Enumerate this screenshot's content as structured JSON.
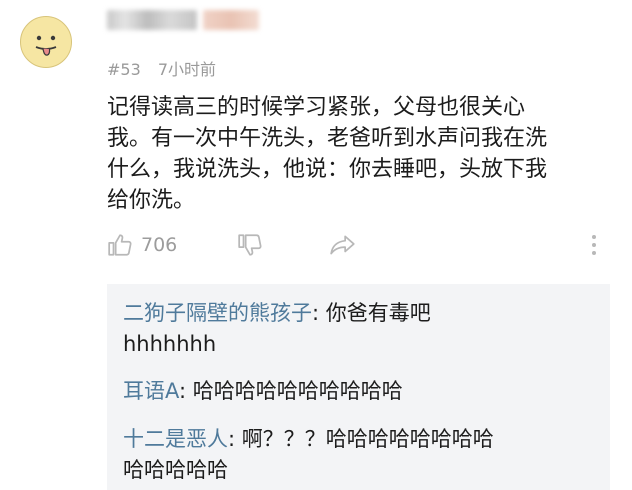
{
  "post": {
    "floor": "#53",
    "time": "7小时前",
    "content_lines": [
      "记得读高三的时候学习紧张，父母也很关心",
      "我。有一次中午洗头，老爸听到水声问我在洗",
      "什么，我说洗头，他说：你去睡吧，头放下我",
      "给你洗。"
    ]
  },
  "actions": {
    "like_icon": "thumbs-up-icon",
    "like_count": "706",
    "dislike_icon": "thumbs-down-icon",
    "share_icon": "share-arrow-icon",
    "more_icon": "vertical-ellipsis-icon"
  },
  "replies": [
    {
      "author": "二狗子隔壁的熊孩子",
      "separator": ": ",
      "lines": [
        "你爸有毒吧",
        "hhhhhhh"
      ]
    },
    {
      "author": "耳语A",
      "separator": ": ",
      "lines": [
        "哈哈哈哈哈哈哈哈哈哈"
      ]
    },
    {
      "author": "十二是恶人",
      "separator": ": ",
      "lines": [
        "啊？？？哈哈哈哈哈哈哈哈",
        "哈哈哈哈哈"
      ]
    }
  ],
  "colors": {
    "reply_author": "#4f7a9b",
    "meta_text": "#9a9a9a",
    "reply_background": "#f3f4f6"
  }
}
